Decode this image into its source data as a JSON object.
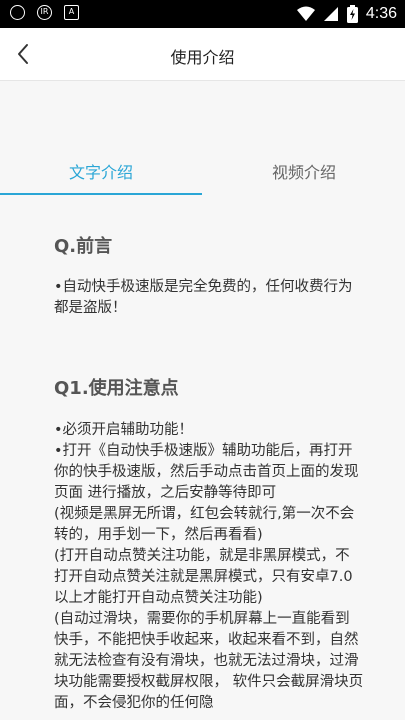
{
  "status_bar": {
    "time": "4:36",
    "icons": [
      "shield-icon",
      "ir-icon",
      "a-icon",
      "wifi-icon",
      "signal-icon",
      "battery-icon"
    ]
  },
  "nav": {
    "title": "使用介绍",
    "back_icon": "chevron-left-icon"
  },
  "tabs": [
    {
      "label": "文字介绍",
      "active": true
    },
    {
      "label": "视频介绍",
      "active": false
    }
  ],
  "colors": {
    "accent": "#2aa6d6",
    "background": "#f7f7f7"
  },
  "sections": [
    {
      "heading": "Q.前言",
      "lines": [
        "•自动快手极速版是完全免费的，任何收费行为都是盗版！"
      ]
    },
    {
      "heading": "Q1.使用注意点",
      "lines": [
        "•必须开启辅助功能！",
        "•打开《自动快手极速版》辅助功能后，再打开你的快手极速版，然后手动点击首页上面的发现 页面 进行播放，之后安静等待即可",
        "(视频是黑屏无所谓，红包会转就行,第一次不会转的，用手划一下，然后再看看)",
        "(打开自动点赞关注功能，就是非黑屏模式，不打开自动点赞关注就是黑屏模式，只有安卓7.0以上才能打开自动点赞关注功能)",
        "(自动过滑块，需要你的手机屏幕上一直能看到快手，不能把快手收起来，收起来看不到，自然就无法检查有没有滑块，也就无法过滑块，过滑块功能需要授权截屏权限， 软件只会截屏滑块页面，不会侵犯你的任何隐"
      ]
    }
  ]
}
